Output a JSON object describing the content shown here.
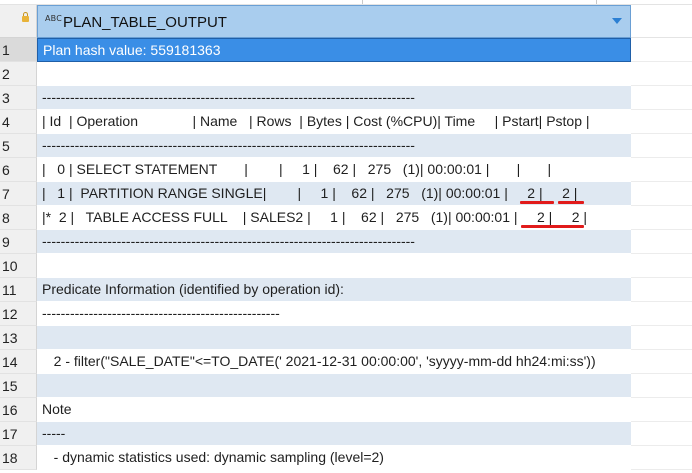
{
  "column": {
    "type_badge": "ABC",
    "title": "PLAN_TABLE_OUTPUT"
  },
  "rows": [
    {
      "num": "1",
      "text": "Plan hash value: 559181363"
    },
    {
      "num": "2",
      "text": ""
    },
    {
      "num": "3",
      "text": "--------------------------------------------------------------------------------"
    },
    {
      "num": "4",
      "text": "| Id  | Operation              | Name   | Rows  | Bytes | Cost (%CPU)| Time     | Pstart| Pstop |"
    },
    {
      "num": "5",
      "text": "--------------------------------------------------------------------------------"
    },
    {
      "num": "6",
      "text": "|   0 | SELECT STATEMENT       |        |     1 |    62 |   275   (1)| 00:00:01 |       |       |"
    },
    {
      "num": "7",
      "text": "|   1 |  PARTITION RANGE SINGLE|        |     1 |    62 |   275   (1)| 00:00:01 |     2 |     2 |"
    },
    {
      "num": "8",
      "text": "|*  2 |   TABLE ACCESS FULL    | SALES2 |     1 |    62 |   275   (1)| 00:00:01 |     2 |     2 |"
    },
    {
      "num": "9",
      "text": "--------------------------------------------------------------------------------"
    },
    {
      "num": "10",
      "text": ""
    },
    {
      "num": "11",
      "text": "Predicate Information (identified by operation id):"
    },
    {
      "num": "12",
      "text": "---------------------------------------------------"
    },
    {
      "num": "13",
      "text": ""
    },
    {
      "num": "14",
      "text": "   2 - filter(\"SALE_DATE\"<=TO_DATE(' 2021-12-31 00:00:00', 'syyyy-mm-dd hh24:mi:ss'))"
    },
    {
      "num": "15",
      "text": ""
    },
    {
      "num": "16",
      "text": "Note"
    },
    {
      "num": "17",
      "text": "-----"
    },
    {
      "num": "18",
      "text": "   - dynamic statistics used: dynamic sampling (level=2)"
    }
  ],
  "annotation_color": "#e11b1b"
}
